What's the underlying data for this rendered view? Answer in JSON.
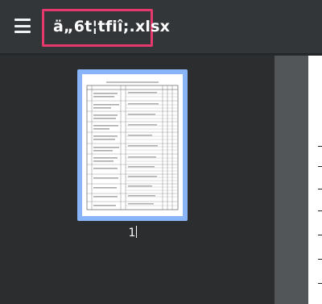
{
  "toolbar": {
    "title": "ä„6t¦tfiî;.xlsx",
    "menu_icon": "hamburger-menu-icon",
    "highlight_color": "#e8396f"
  },
  "sidebar": {
    "thumbnails": [
      {
        "page_label": "1",
        "selected": true
      }
    ]
  },
  "colors": {
    "toolbar_bg": "#323639",
    "sidebar_bg": "#2b2d2f",
    "selection": "#8ab4f8",
    "viewer_bg": "#525659"
  }
}
